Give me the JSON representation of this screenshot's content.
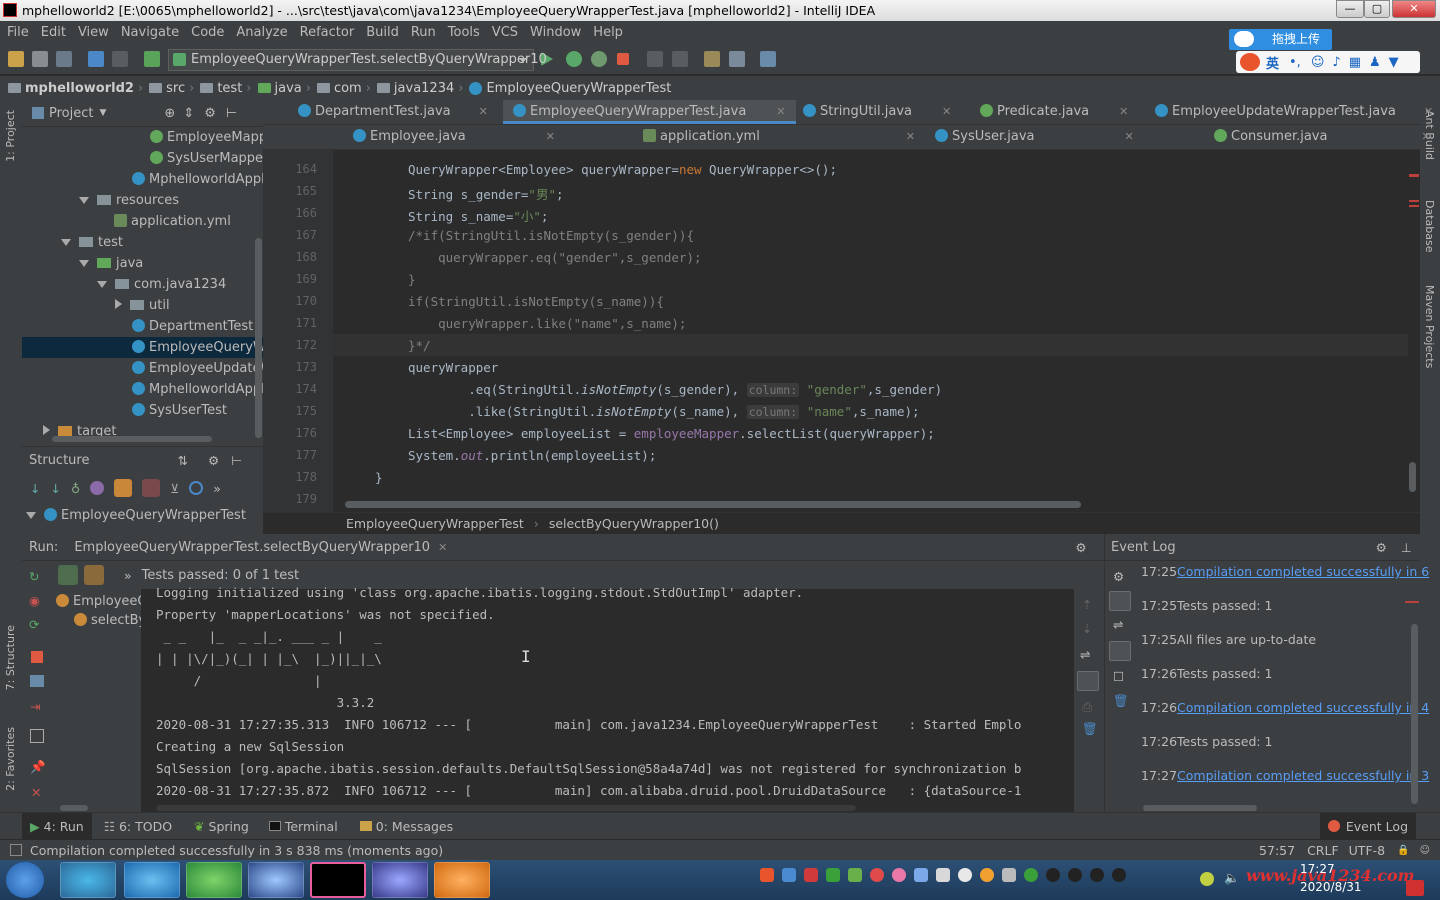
{
  "window": {
    "title": "mphelloworld2 [E:\\0065\\mphelloworld2] - ...\\src\\test\\java\\com\\java1234\\EmployeeQueryWrapperTest.java [mphelloworld2] - IntelliJ IDEA"
  },
  "menu": [
    "File",
    "Edit",
    "View",
    "Navigate",
    "Code",
    "Analyze",
    "Refactor",
    "Build",
    "Run",
    "Tools",
    "VCS",
    "Window",
    "Help"
  ],
  "toolbar": {
    "run_config": "EmployeeQueryWrapperTest.selectByQueryWrapper10",
    "upload_btn": "拖拽上传",
    "ime_lang": "英"
  },
  "breadcrumb": [
    "mphelloworld2",
    "src",
    "test",
    "java",
    "com",
    "java1234",
    "EmployeeQueryWrapperTest"
  ],
  "project": {
    "header": "Project",
    "items": [
      {
        "label": "EmployeeMapp",
        "type": "class-green"
      },
      {
        "label": "SysUserMapper",
        "type": "class-green"
      },
      {
        "label": "MphelloworldAppli",
        "type": "class"
      },
      {
        "label": "resources",
        "type": "folder-open"
      },
      {
        "label": "application.yml",
        "type": "file"
      },
      {
        "label": "test",
        "type": "folder-open"
      },
      {
        "label": "java",
        "type": "folder-open"
      },
      {
        "label": "com.java1234",
        "type": "folder-open"
      },
      {
        "label": "util",
        "type": "folder-closed"
      },
      {
        "label": "DepartmentTest",
        "type": "class"
      },
      {
        "label": "EmployeeQueryWra",
        "type": "class"
      },
      {
        "label": "EmployeeUpdateW",
        "type": "class"
      },
      {
        "label": "MphelloworldAppli",
        "type": "class"
      },
      {
        "label": "SysUserTest",
        "type": "class"
      },
      {
        "label": "target",
        "type": "folder-closed"
      }
    ]
  },
  "structure": {
    "header": "Structure",
    "root": "EmployeeQueryWrapperTest"
  },
  "tabs_row1": [
    "DepartmentTest.java",
    "EmployeeQueryWrapperTest.java",
    "StringUtil.java",
    "Predicate.java",
    "EmployeeUpdateWrapperTest.java"
  ],
  "tabs_row2": [
    "Employee.java",
    "application.yml",
    "SysUser.java",
    "Consumer.java"
  ],
  "editor": {
    "line_numbers": [
      "164",
      "165",
      "166",
      "167",
      "168",
      "169",
      "170",
      "171",
      "172",
      "173",
      "174",
      "175",
      "176",
      "177",
      "178",
      "179"
    ],
    "hint_column": "column:",
    "breadcrumb": [
      "EmployeeQueryWrapperTest",
      "selectByQueryWrapper10()"
    ]
  },
  "run": {
    "label": "Run:",
    "tab": "EmployeeQueryWrapperTest.selectByQueryWrapper10",
    "tests": "Tests passed: 0 of 1 test",
    "tree_root": "EmployeeQ",
    "tree_child": "selectBy",
    "console": [
      "Logging initialized using 'class org.apache.ibatis.logging.stdout.StdOutImpl' adapter.",
      "Property 'mapperLocations' was not specified.",
      " _ _   |_  _ _|_. ___ _ |    _",
      "| | |\\/|_)(_| | |_\\  |_)||_|_\\",
      "     /               |",
      "                        3.3.2",
      "2020-08-31 17:27:35.313  INFO 106712 --- [           main] com.java1234.EmployeeQueryWrapperTest    : Started Emplo",
      "Creating a new SqlSession",
      "SqlSession [org.apache.ibatis.session.defaults.DefaultSqlSession@58a4a74d] was not registered for synchronization b",
      "2020-08-31 17:27:35.872  INFO 106712 --- [           main] com.alibaba.druid.pool.DruidDataSource   : {dataSource-1"
    ]
  },
  "eventlog": {
    "title": "Event Log",
    "entries": [
      {
        "time": "17:25",
        "text": "Compilation completed successfully in 6",
        "link": true
      },
      {
        "time": "17:25",
        "text": "Tests passed: 1",
        "link": false
      },
      {
        "time": "17:25",
        "text": "All files are up-to-date",
        "link": false
      },
      {
        "time": "17:26",
        "text": "Tests passed: 1",
        "link": false
      },
      {
        "time": "17:26",
        "text": "Compilation completed successfully in 4",
        "link": true
      },
      {
        "time": "17:26",
        "text": "Tests passed: 1",
        "link": false
      },
      {
        "time": "17:27",
        "text": "Compilation completed successfully in 3",
        "link": true
      }
    ]
  },
  "bottom_tabs": [
    "4: Run",
    "6: TODO",
    "Spring",
    "Terminal",
    "0: Messages",
    "Event Log"
  ],
  "side_left": [
    "1: Project",
    "7: Structure",
    "2: Favorites"
  ],
  "side_right": [
    "Ant Build",
    "Database",
    "Maven Projects"
  ],
  "status": {
    "message": "Compilation completed successfully in 3 s 838 ms (moments ago)",
    "position": "57:57",
    "line_sep": "CRLF",
    "encoding": "UTF-8"
  },
  "taskbar": {
    "time": "17:27",
    "date": "2020/8/31",
    "watermark": "www.java1234.com"
  },
  "colors": {
    "bg": "#2b2b2b",
    "panel": "#3c3f41",
    "keyword": "#cc7832",
    "string": "#6a8759",
    "comment": "#808080",
    "link": "#589df6"
  }
}
